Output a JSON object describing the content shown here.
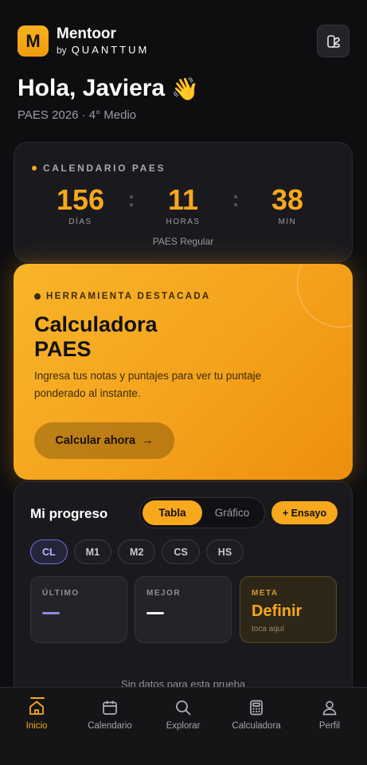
{
  "header": {
    "logo_letter": "M",
    "app_name": "Mentoor",
    "by_label": "by",
    "partner": "QUANTTUM",
    "greeting": "Hola, Javiera",
    "greeting_emoji": "👋",
    "subtitle": "PAES 2026 · 4° Medio",
    "theme_icon": "theme-toggle-icon"
  },
  "calendar": {
    "title": "CALENDARIO PAES",
    "days": {
      "value": "156",
      "label": "DÍAS"
    },
    "hours": {
      "value": "11",
      "label": "HORAS"
    },
    "minutes": {
      "value": "38",
      "label": "MIN"
    },
    "footer": "PAES Regular"
  },
  "featured": {
    "tag": "HERRAMIENTA DESTACADA",
    "title_line1": "Calculadora",
    "title_line2": "PAES",
    "description": "Ingresa tus notas y puntajes para ver tu puntaje ponderado al instante.",
    "button_label": "Calcular ahora",
    "button_arrow": "→"
  },
  "progress": {
    "title": "Mi progreso",
    "tabs": [
      {
        "label": "Tabla",
        "active": true
      },
      {
        "label": "Gráfico",
        "active": false
      }
    ],
    "add_button": "+ Ensayo",
    "subjects": [
      {
        "label": "CL",
        "active": true
      },
      {
        "label": "M1",
        "active": false
      },
      {
        "label": "M2",
        "active": false
      },
      {
        "label": "CS",
        "active": false
      },
      {
        "label": "HS",
        "active": false
      }
    ],
    "stats": {
      "last": {
        "label": "ÚLTIMO",
        "value": "—"
      },
      "best": {
        "label": "MEJOR",
        "value": "—"
      },
      "goal": {
        "label": "META",
        "value": "Definir",
        "hint": "toca aquí"
      }
    },
    "empty_message": "Sin datos para esta prueba"
  },
  "nav": {
    "items": [
      {
        "label": "Inicio",
        "icon": "home-icon",
        "active": true
      },
      {
        "label": "Calendario",
        "icon": "calendar-icon",
        "active": false
      },
      {
        "label": "Explorar",
        "icon": "search-icon",
        "active": false
      },
      {
        "label": "Calculadora",
        "icon": "calculator-icon",
        "active": false
      },
      {
        "label": "Perfil",
        "icon": "profile-icon",
        "active": false
      }
    ]
  },
  "colors": {
    "accent": "#f7a81c",
    "background": "#0e0e10",
    "card": "#1a1a1e",
    "selected_chip": "#6f6ce0"
  }
}
